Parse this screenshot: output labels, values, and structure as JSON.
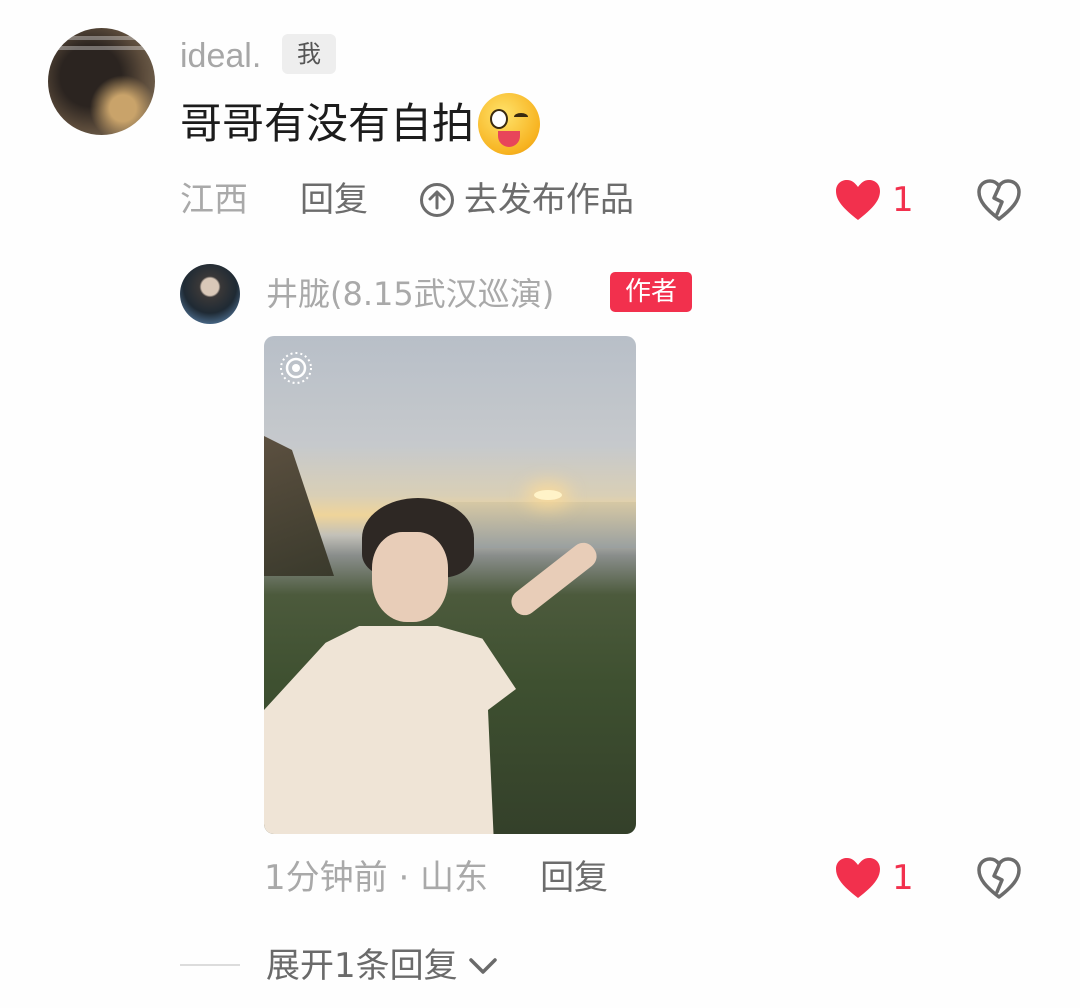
{
  "comment": {
    "username": "ideal.",
    "me_badge": "我",
    "text": "哥哥有没有自拍",
    "emoji": "winking-face-with-tongue",
    "location": "江西",
    "reply_label": "回复",
    "publish_label": "去发布作品",
    "like_count": "1"
  },
  "reply": {
    "username": "井胧(8.15武汉巡演)",
    "author_badge": "作者",
    "time_location": "1分钟前 · 山东",
    "reply_label": "回复",
    "like_count": "1"
  },
  "expand_label": "展开1条回复",
  "colors": {
    "accent_red": "#f2304d",
    "text_gray": "#a9a9a9",
    "text_dark": "#1c1c1c"
  }
}
